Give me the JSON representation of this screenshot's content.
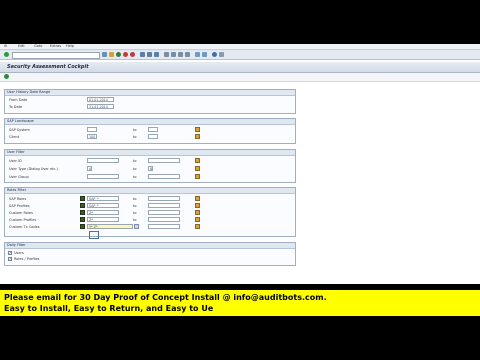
{
  "menu": [
    "⚙",
    "Edit",
    "Goto",
    "Extras",
    "Help"
  ],
  "title": "Security Assessment Cockpit",
  "groups": {
    "user_history": {
      "title": "User History  Date Range",
      "from_label": "From Date",
      "from_value": "01.01.2014",
      "to_label": "To Date",
      "to_value": "31.01.2014"
    },
    "landscape": {
      "title": "SAP Landscape",
      "system_label": "SAP System",
      "system_value": "",
      "client_label": "Client",
      "client_value": "100",
      "to": "to"
    },
    "user_filter": {
      "title": "User Filter",
      "rows": [
        {
          "label": "User ID",
          "value": "",
          "to_value": ""
        },
        {
          "label": "User Type (Dialog User etc.)",
          "value": "A",
          "to_value": "B"
        },
        {
          "label": "User Group",
          "value": "",
          "to_value": ""
        }
      ],
      "to": "to"
    },
    "roles_filter": {
      "title": "Roles Filter",
      "rows": [
        {
          "label": "SAP Roles",
          "value": "SAP_*"
        },
        {
          "label": "SAP Profiles",
          "value": "SAP_*"
        },
        {
          "label": "Custom Roles",
          "value": "Z*"
        },
        {
          "label": "Custom Profiles",
          "value": "Z*"
        },
        {
          "label": "Custom Tx Codes",
          "value": "Y*,Z*"
        }
      ],
      "to": "to"
    },
    "daily_filter": {
      "title": "Daily Filter",
      "items": [
        {
          "label": "Users",
          "checked": true
        },
        {
          "label": "Roles / Profiles",
          "checked": true
        }
      ]
    }
  },
  "banner": {
    "line1": "Please email for 30 Day Proof of Concept Install @ info@auditbots.com.",
    "line2": "Easy to Install, Easy to Return, and Easy to Ue"
  },
  "colors": {
    "banner_bg": "#ffff00",
    "highlight_field": "#fff6b0"
  }
}
